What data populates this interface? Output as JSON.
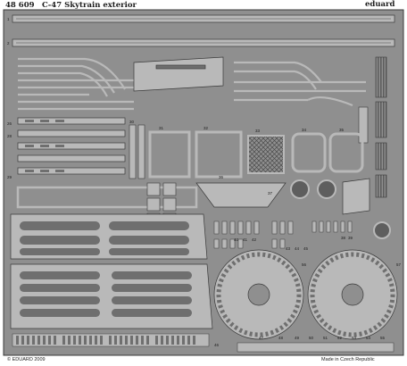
{
  "fret": {
    "set_number": "48 609",
    "title": "C-47 Skytrain exterior",
    "brand": "eduard",
    "copyright": "© EDUARD 2009",
    "origin": "Made in Czech Republic"
  },
  "part_numbers": [
    "1",
    "2",
    "26",
    "28",
    "29",
    "30",
    "31",
    "32",
    "33",
    "34",
    "35",
    "36",
    "37",
    "38",
    "39",
    "40",
    "41",
    "42",
    "43",
    "44",
    "45",
    "46",
    "47",
    "48",
    "49",
    "50",
    "51",
    "52",
    "53",
    "54",
    "55",
    "56",
    "57"
  ],
  "colors": {
    "fret_background": "#8f8f8f",
    "etched_metal": "#b9b9b9",
    "recess": "#6f6f6f",
    "outline": "#3a3a3a"
  }
}
